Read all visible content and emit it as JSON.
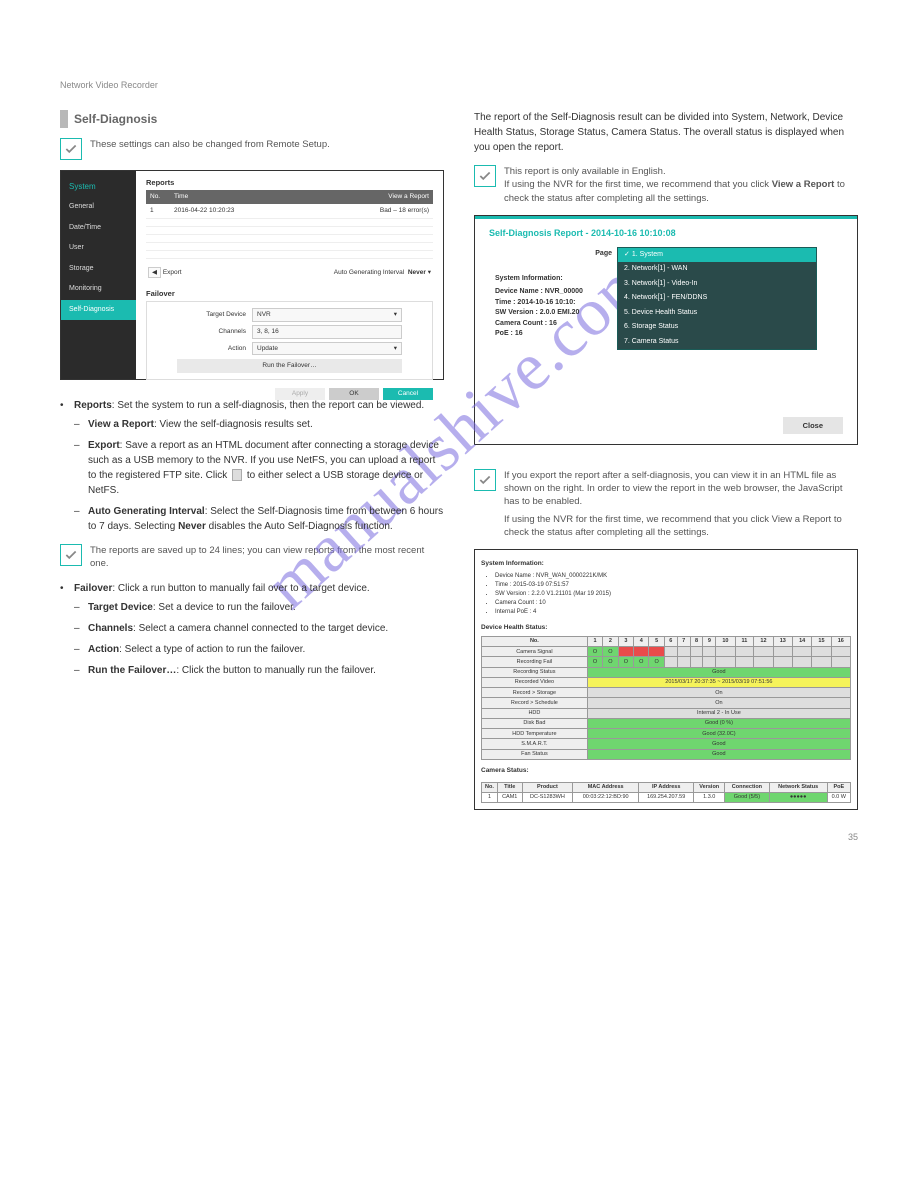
{
  "page_header": {
    "left": "Network Video Recorder",
    "right": ""
  },
  "section": {
    "title": "Self-Diagnosis"
  },
  "note1": "These settings can also be changed from Remote Setup.",
  "note2": {
    "lead": "This report is only available in English.",
    "line2_prefix": "If using the NVR for the first time, we recommend that you click ",
    "line2_bold": "View a Report",
    "line2_suffix": " to check the status after completing all the settings."
  },
  "note3": {
    "lead": "If you export the report after a self-diagnosis, you can view it in an HTML file as shown on the right. In order to view the report in the web browser, the JavaScript has to be enabled.",
    "line2": "If using the NVR for the first time, we recommend that you click View a Report to check the status after completing all the settings."
  },
  "bullets": {
    "reports": {
      "label": "Reports",
      "text": ": Set the system to run a self-diagnosis, then the report can be viewed.",
      "items": [
        {
          "label": "View a Report",
          "text": ": View the self-diagnosis results set."
        },
        {
          "label": "Export",
          "text": ": Save a report as an HTML document after connecting a storage device such as a USB memory to the NVR. If you use NetFS, you can upload a report to the registered FTP site. Click ",
          "icon": true,
          "text2": " to either select a USB storage device or NetFS."
        },
        {
          "label": "Auto Generating Interval",
          "text": ": Select the Self-Diagnosis time from between 6 hours to 7 days. Selecting ",
          "bold": "Never",
          "text2": " disables the Auto Self-Diagnosis function."
        }
      ]
    }
  },
  "note4": "The reports are saved up to 24 lines; you can view reports from the most recent one.",
  "bullets2": {
    "failover": {
      "label": "Failover",
      "text": ": Click a run button to manually fail over to a target device.",
      "items": [
        {
          "label": "Target Device",
          "text": ": Set a device to run the failover."
        },
        {
          "label": "Channels",
          "text": ": Select a camera channel connected to the target device."
        },
        {
          "label": "Action",
          "text": ": Select a type of action to run the failover."
        },
        {
          "label": "Run the Failover…",
          "text": ": Click the button to manually run the failover."
        }
      ]
    }
  },
  "right_intro": "The report of the Self-Diagnosis result can be divided into System, Network, Device Health Status, Storage Status, Camera Status. The overall status is displayed when you open the report.",
  "shot1": {
    "sidebar": {
      "header": "System",
      "items": [
        "General",
        "Date/Time",
        "User",
        "Storage",
        "Monitoring",
        "Self-Diagnosis"
      ],
      "selected": 5
    },
    "reports_label": "Reports",
    "cols": [
      "No.",
      "Time",
      "View a Report"
    ],
    "row": {
      "no": "1",
      "time": "2016-04-22 10:20:23",
      "view": "Bad – 18 error(s)"
    },
    "pager_left": "Export",
    "pager_right_label": "Auto Generating Interval",
    "pager_right_val": "Never",
    "failover": {
      "title": "Failover",
      "target_label": "Target Device",
      "target_val": "NVR",
      "channels_label": "Channels",
      "channels_val": "3, 8, 16",
      "action_label": "Action",
      "action_val": "Update",
      "run": "Run the Failover…"
    },
    "buttons": {
      "apply": "Apply",
      "ok": "OK",
      "cancel": "Cancel"
    }
  },
  "shot2": {
    "title": "Self-Diagnosis Report - 2014-10-16 10:10:08",
    "page_label": "Page",
    "options": [
      "1. System",
      "2. Network[1] - WAN",
      "3. Network[1] - Video-In",
      "4. Network[1] - FEN/DDNS",
      "5. Device Health Status",
      "6. Storage Status",
      "7. Camera Status"
    ],
    "sys_header": "System Information:",
    "sys_lines": [
      "Device Name : NVR_00000",
      "Time : 2014-10-16 10:10:",
      "SW Version : 2.0.0 EMI.20",
      "Camera Count : 16",
      "PoE : 16"
    ],
    "close": "Close"
  },
  "shot3": {
    "sys_header": "System Information:",
    "sys_items": [
      "Device Name : NVR_WAN_0000221K/MK",
      "Time : 2015-03-19 07:51:57",
      "SW Version : 2.2.0 V1.21101 (Mar 19 2015)",
      "Camera Count : 10",
      "Internal PoE : 4"
    ],
    "dhs_header": "Device Health Status:",
    "cols": [
      "No.",
      "1",
      "2",
      "3",
      "4",
      "5",
      "6",
      "7",
      "8",
      "9",
      "10",
      "11",
      "12",
      "13",
      "14",
      "15",
      "16"
    ],
    "rows": [
      {
        "label": "Camera Signal",
        "cells": [
          "g",
          "g",
          "r",
          "r",
          "r",
          "",
          "",
          "",
          "",
          "",
          "",
          "",
          "",
          "",
          "",
          ""
        ]
      },
      {
        "label": "Recording Fail",
        "cells": [
          "g",
          "g",
          "g",
          "g",
          "g",
          "",
          "",
          "",
          "",
          "",
          "",
          "",
          "",
          "",
          "",
          ""
        ]
      }
    ],
    "wide_rows": [
      {
        "label": "Recording Status",
        "val": "Good",
        "cls": "g"
      },
      {
        "label": "Recorded Video",
        "val": "2015/03/17 20:37:35 ~ 2015/03/19 07:51:56",
        "cls": "y"
      },
      {
        "label": "Record > Storage",
        "val": "On",
        "cls": "gy"
      },
      {
        "label": "Record > Schedule",
        "val": "On",
        "cls": "gy"
      },
      {
        "label": "HDD",
        "val": "Internal 2 - In Use",
        "cls": "gy"
      },
      {
        "label": "Disk Bad",
        "val": "Good (0 %)",
        "cls": "g"
      },
      {
        "label": "HDD Temperature",
        "val": "Good (32.0C)",
        "cls": "g"
      },
      {
        "label": "S.M.A.R.T.",
        "val": "Good",
        "cls": "g"
      },
      {
        "label": "Fan Status",
        "val": "Good",
        "cls": "g"
      }
    ],
    "cam_header": "Camera Status:",
    "cam_cols": [
      "No.",
      "Title",
      "Product",
      "MAC Address",
      "IP Address",
      "Version",
      "Connection",
      "Network Status",
      "PoE"
    ],
    "cam_row": [
      "1",
      "CAM1",
      "DC-S1283WH",
      "00:03:22:12:BD:90",
      "169.254.207.59",
      "1.3.0",
      "Good (5/5)",
      "●●●●●",
      "0.0 W"
    ]
  },
  "watermark": "manualshive.com",
  "page_number": "35"
}
